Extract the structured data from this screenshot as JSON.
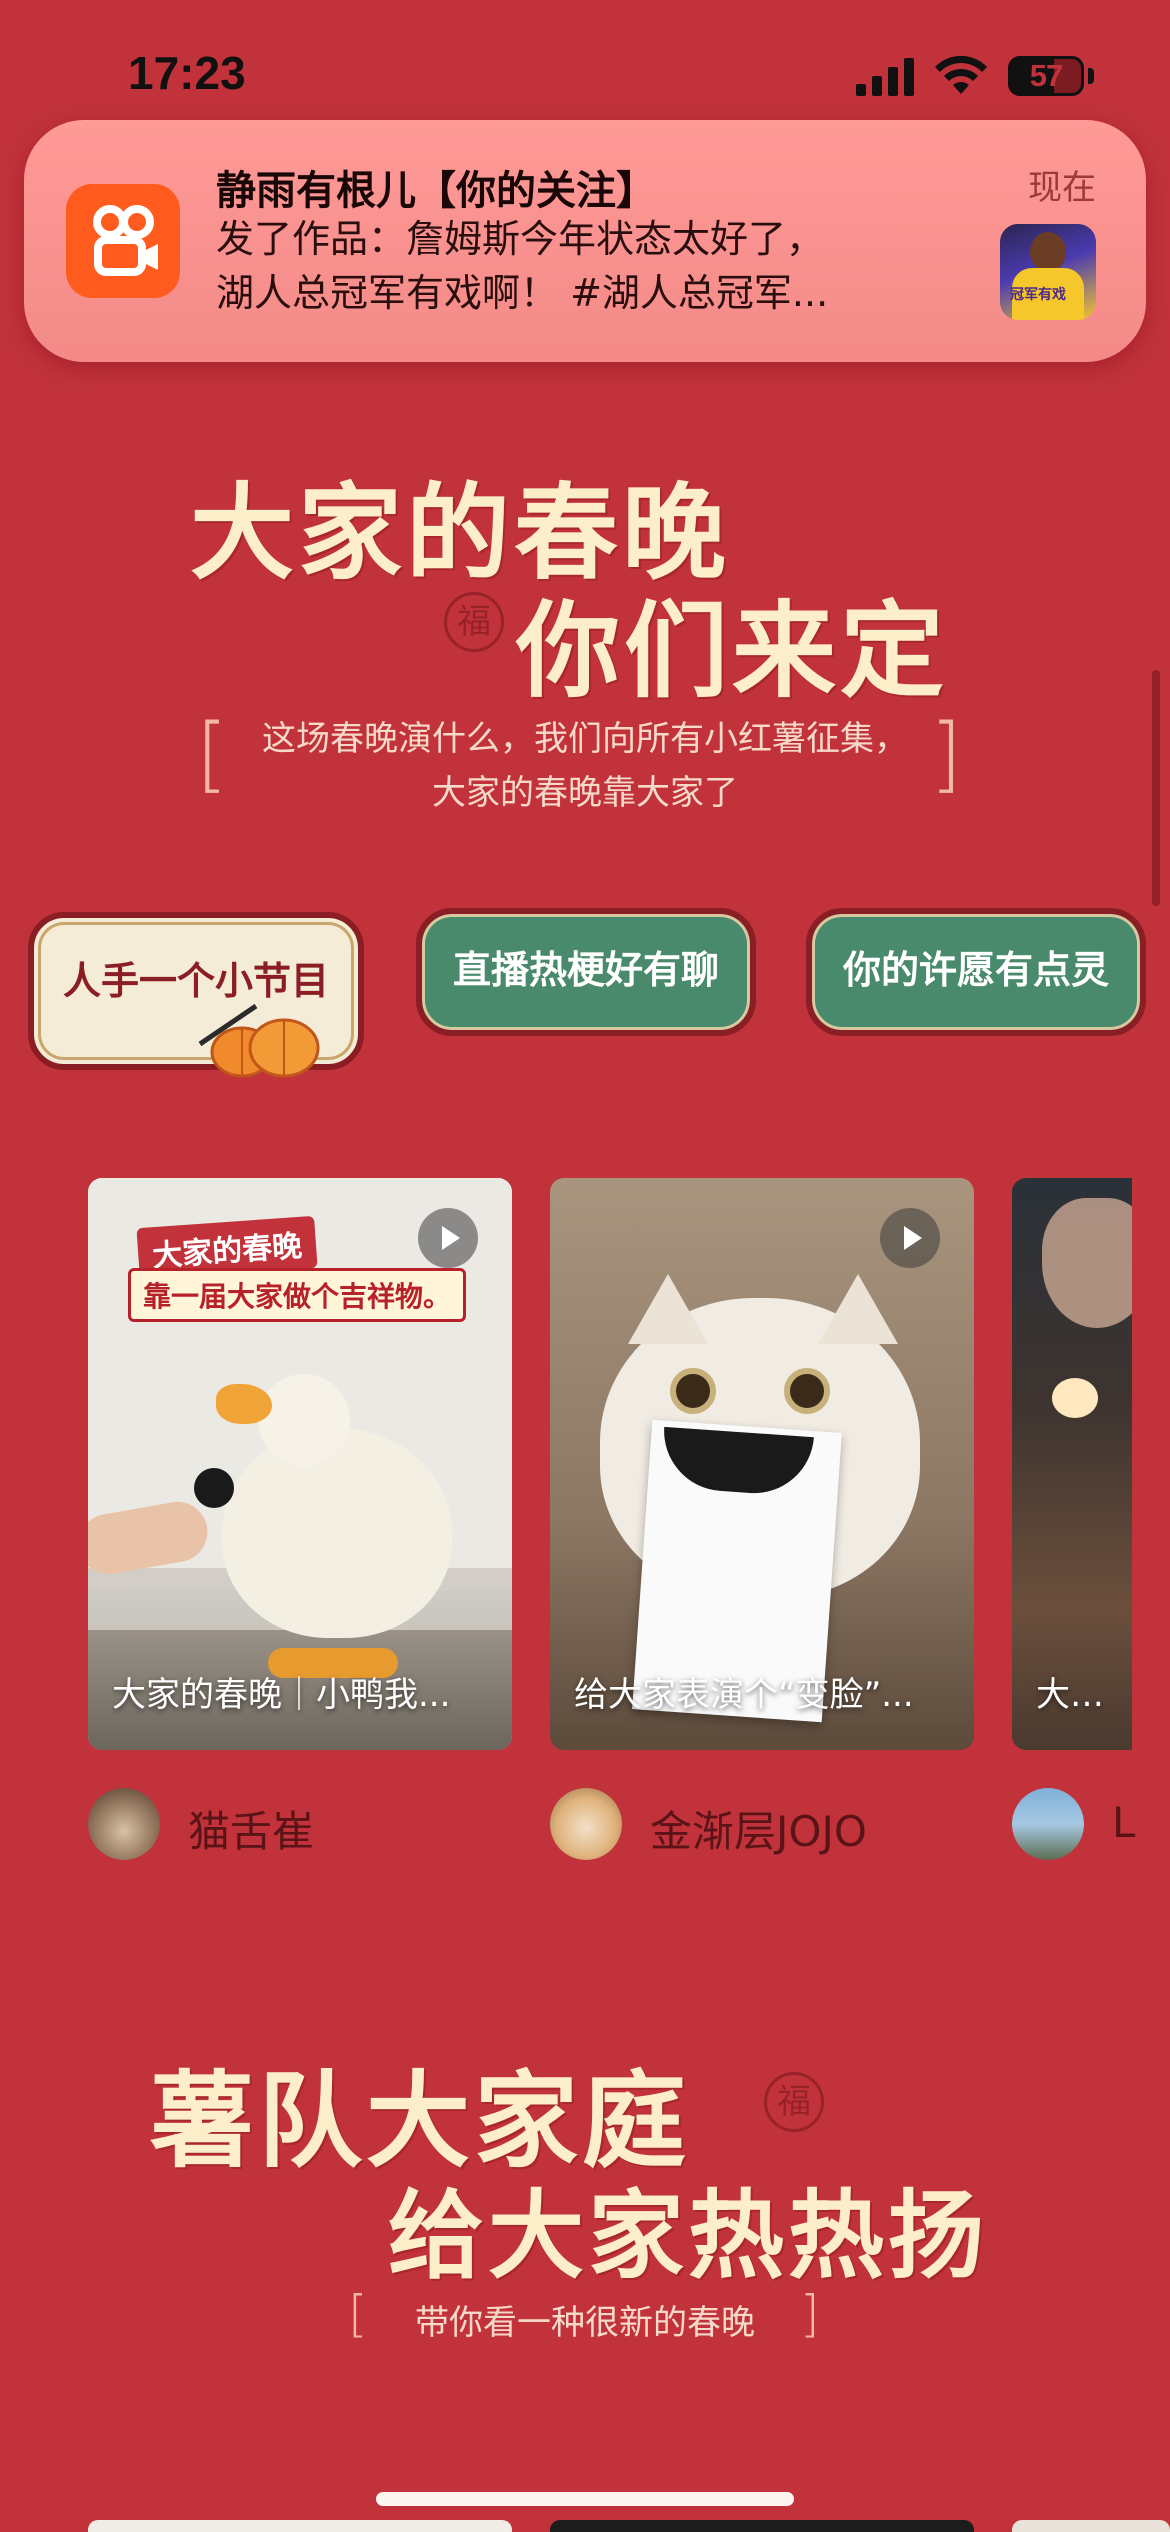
{
  "status_bar": {
    "time": "17:23",
    "battery": "57"
  },
  "notification": {
    "title": "静雨有根儿【你的关注】",
    "time": "现在",
    "line1": "发了作品：詹姆斯今年状态太好了，",
    "line2": "湖人总冠军有戏啊！ #湖人总冠军...",
    "thumb_label": "冠军有戏"
  },
  "hero": {
    "line1": "大家的春晚",
    "line2": "你们来定",
    "seal": "福",
    "sub1": "这场春晚演什么，我们向所有小红薯征集，",
    "sub2": "大家的春晚靠大家了"
  },
  "tabs": [
    {
      "label": "人手一个小节目"
    },
    {
      "label": "直播热梗好有聊"
    },
    {
      "label": "你的许愿有点灵"
    }
  ],
  "cards": [
    {
      "caption": "大家的春晚｜小鸭我...",
      "overlay_line1": "大家的春晚",
      "overlay_line2": "靠一届大家做个吉祥物。"
    },
    {
      "caption": "给大家表演个“变脸”..."
    },
    {
      "caption": "大家的"
    }
  ],
  "authors": [
    {
      "name": "猫舌崔"
    },
    {
      "name": "金渐层JOJO"
    },
    {
      "name": "L"
    }
  ],
  "section2": {
    "line1": "薯队大家庭",
    "line2": "给大家热热扬",
    "seal": "福",
    "sub": "带你看一种很新的春晚"
  }
}
